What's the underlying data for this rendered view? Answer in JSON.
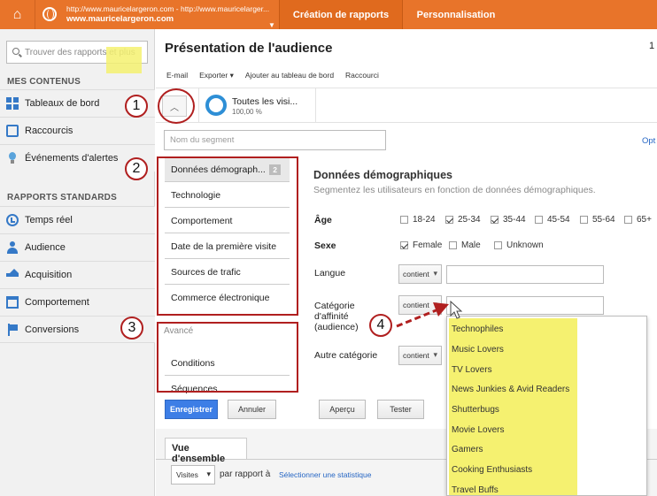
{
  "topbar": {
    "property_url": "http://www.mauricelargeron.com - http://www.mauricelarger...",
    "property_name": "www.mauricelargeron.com",
    "tab_reports": "Création de rapports",
    "tab_custom": "Personnalisation"
  },
  "sidebar": {
    "search_placeholder": "Trouver des rapports et plus",
    "section_content": "MES CONTENUS",
    "content_items": [
      "Tableaux de bord",
      "Raccourcis",
      "Événements d'alertes"
    ],
    "section_standard": "RAPPORTS STANDARDS",
    "standard_items": [
      "Temps réel",
      "Audience",
      "Acquisition",
      "Comportement",
      "Conversions"
    ]
  },
  "main": {
    "title": "Présentation de l'audience",
    "page_indicator": "1",
    "actions": [
      "E-mail",
      "Exporter ▾",
      "Ajouter au tableau de bord",
      "Raccourci"
    ],
    "segment_chip": {
      "name": "Toutes les visi...",
      "percent": "100,00 %"
    },
    "segment_name_placeholder": "Nom du segment",
    "options_link": "Opt"
  },
  "editor": {
    "categories": [
      {
        "label": "Données démograph...",
        "badge": "2"
      },
      {
        "label": "Technologie"
      },
      {
        "label": "Comportement"
      },
      {
        "label": "Date de la première visite"
      },
      {
        "label": "Sources de trafic"
      },
      {
        "label": "Commerce électronique"
      }
    ],
    "advanced_label": "Avancé",
    "advanced_items": [
      "Conditions",
      "Séquences"
    ],
    "form_title": "Données démographiques",
    "form_subtitle": "Segmentez les utilisateurs en fonction de données démographiques.",
    "age_label": "Âge",
    "age_options": [
      {
        "label": "18-24",
        "checked": false
      },
      {
        "label": "25-34",
        "checked": true
      },
      {
        "label": "35-44",
        "checked": true
      },
      {
        "label": "45-54",
        "checked": false
      },
      {
        "label": "55-64",
        "checked": false
      },
      {
        "label": "65+",
        "checked": false
      }
    ],
    "sex_label": "Sexe",
    "sex_options": [
      {
        "label": "Female",
        "checked": true
      },
      {
        "label": "Male",
        "checked": false
      },
      {
        "label": "Unknown",
        "checked": false
      }
    ],
    "language_label": "Langue",
    "affinity_label_1": "Catégorie",
    "affinity_label_2": "d'affinité",
    "affinity_label_3": "(audience)",
    "other_label": "Autre catégorie",
    "operator": "contient",
    "affinity_suggestions": [
      "Technophiles",
      "Music Lovers",
      "TV Lovers",
      "News Junkies & Avid Readers",
      "Shutterbugs",
      "Movie Lovers",
      "Gamers",
      "Cooking Enthusiasts",
      "Travel Buffs"
    ]
  },
  "buttons": {
    "save": "Enregistrer",
    "cancel": "Annuler",
    "preview": "Aperçu",
    "test": "Tester"
  },
  "overview": {
    "tab": "Vue d'ensemble",
    "metric": "Visites",
    "compare_text": "par rapport à",
    "select_stat": "Sélectionner une statistique"
  },
  "annotations": {
    "n1": "1",
    "n2": "2",
    "n3": "3",
    "n4": "4"
  },
  "colors": {
    "brand_orange": "#e8742a",
    "highlight_yellow": "#f5f170",
    "annotation_red": "#b01f1f",
    "primary_blue": "#3d7ee6"
  }
}
